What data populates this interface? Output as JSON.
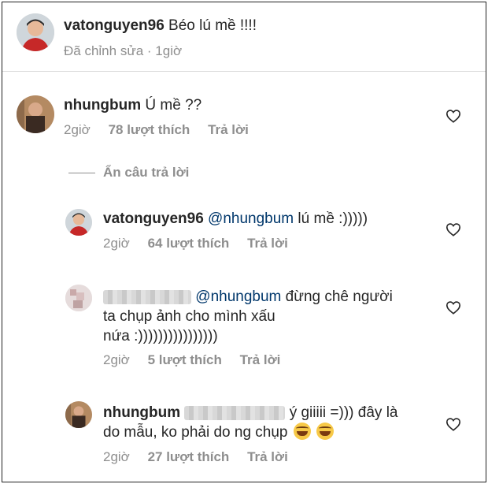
{
  "caption": {
    "username": "vatonguyen96",
    "text": "Béo lú mề !!!!",
    "edited": "Đã chỉnh sửa",
    "dot": "·",
    "time": "1giờ"
  },
  "comments": [
    {
      "username": "nhungbum",
      "text": "Ú mề ??",
      "time": "2giờ",
      "likes": "78 lượt thích",
      "reply": "Trả lời"
    }
  ],
  "hide_replies": "Ẩn câu trả lời",
  "replies": [
    {
      "username": "vatonguyen96",
      "mention": "@nhungbum",
      "text": "lú mề :)))))",
      "time": "2giờ",
      "likes": "64 lượt thích",
      "reply": "Trả lời"
    },
    {
      "username": "",
      "mention": "@nhungbum",
      "text_line1": "đừng chê người",
      "text_line2": "ta chụp ảnh cho mình xấu",
      "text_line3": "nứa :))))))))))))))))",
      "time": "2giờ",
      "likes": "5 lượt thích",
      "reply": "Trả lời"
    },
    {
      "username": "nhungbum",
      "text_line1": "ý giiiii =))) đây là",
      "text_line2": "do mẫu, ko phải do ng chụp",
      "time": "2giờ",
      "likes": "27 lượt thích",
      "reply": "Trả lời"
    }
  ],
  "icons": {
    "like": "heart-outline-icon",
    "emoji": "rofl-emoji-icon"
  },
  "colors": {
    "text": "#262626",
    "meta": "#8e8e8e",
    "mention": "#00376b",
    "divider": "#dbdbdb"
  }
}
